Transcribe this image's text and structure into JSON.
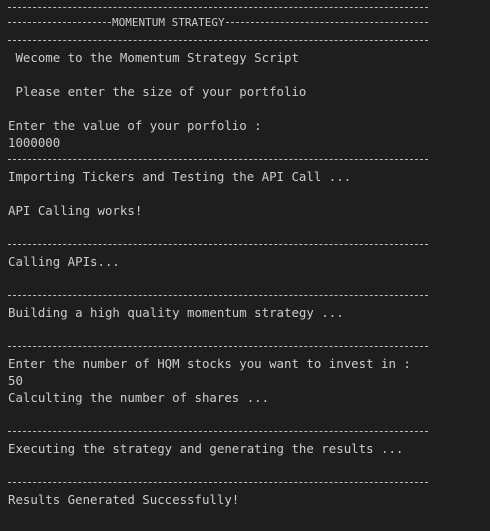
{
  "terminal": {
    "title": "MOMENTUM STRATEGY",
    "welcome": " Wecome to the Momentum Strategy Script",
    "prompt_size": " Please enter the size of your portfolio",
    "enter_value_label": "Enter the value of your porfolio :",
    "portfolio_value": "1000000",
    "importing": "Importing Tickers and Testing the API Call ...",
    "api_works": "API Calling works!",
    "calling_apis": "Calling APIs...",
    "building": "Building a high quality momentum strategy ...",
    "enter_hqm_label": "Enter the number of HQM stocks you want to invest in :",
    "hqm_value": "50",
    "calculating": "Calculting the number of shares ...",
    "executing": "Executing the strategy and generating the results ...",
    "results": "Results Generated Successfully!"
  },
  "colors": {
    "background": "#1e1e1e",
    "text": "#cccccc",
    "separator": "#bdbdbd"
  }
}
